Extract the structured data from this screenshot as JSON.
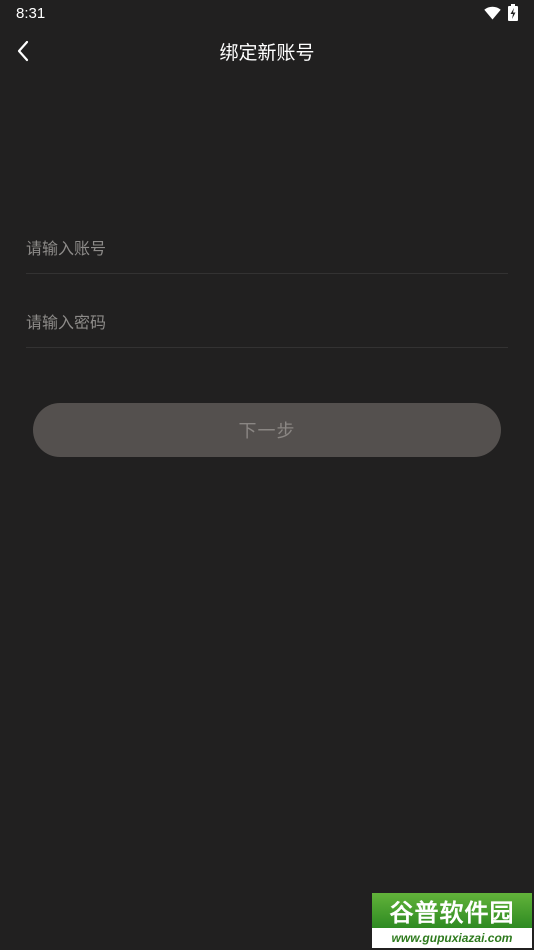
{
  "status_bar": {
    "time": "8:31",
    "wifi_icon": "wifi-icon",
    "battery_icon": "battery-charging-icon"
  },
  "header": {
    "back_icon": "chevron-left-icon",
    "title": "绑定新账号"
  },
  "form": {
    "account_placeholder": "请输入账号",
    "account_value": "",
    "password_placeholder": "请输入密码",
    "password_value": "",
    "next_label": "下一步"
  },
  "watermark": {
    "brand": "谷普软件园",
    "url": "www.gupuxiazai.com"
  },
  "colors": {
    "background": "#212020",
    "button_bg": "#54504e",
    "button_text": "#8a8683",
    "placeholder": "#8d8b89",
    "divider": "#333232"
  }
}
